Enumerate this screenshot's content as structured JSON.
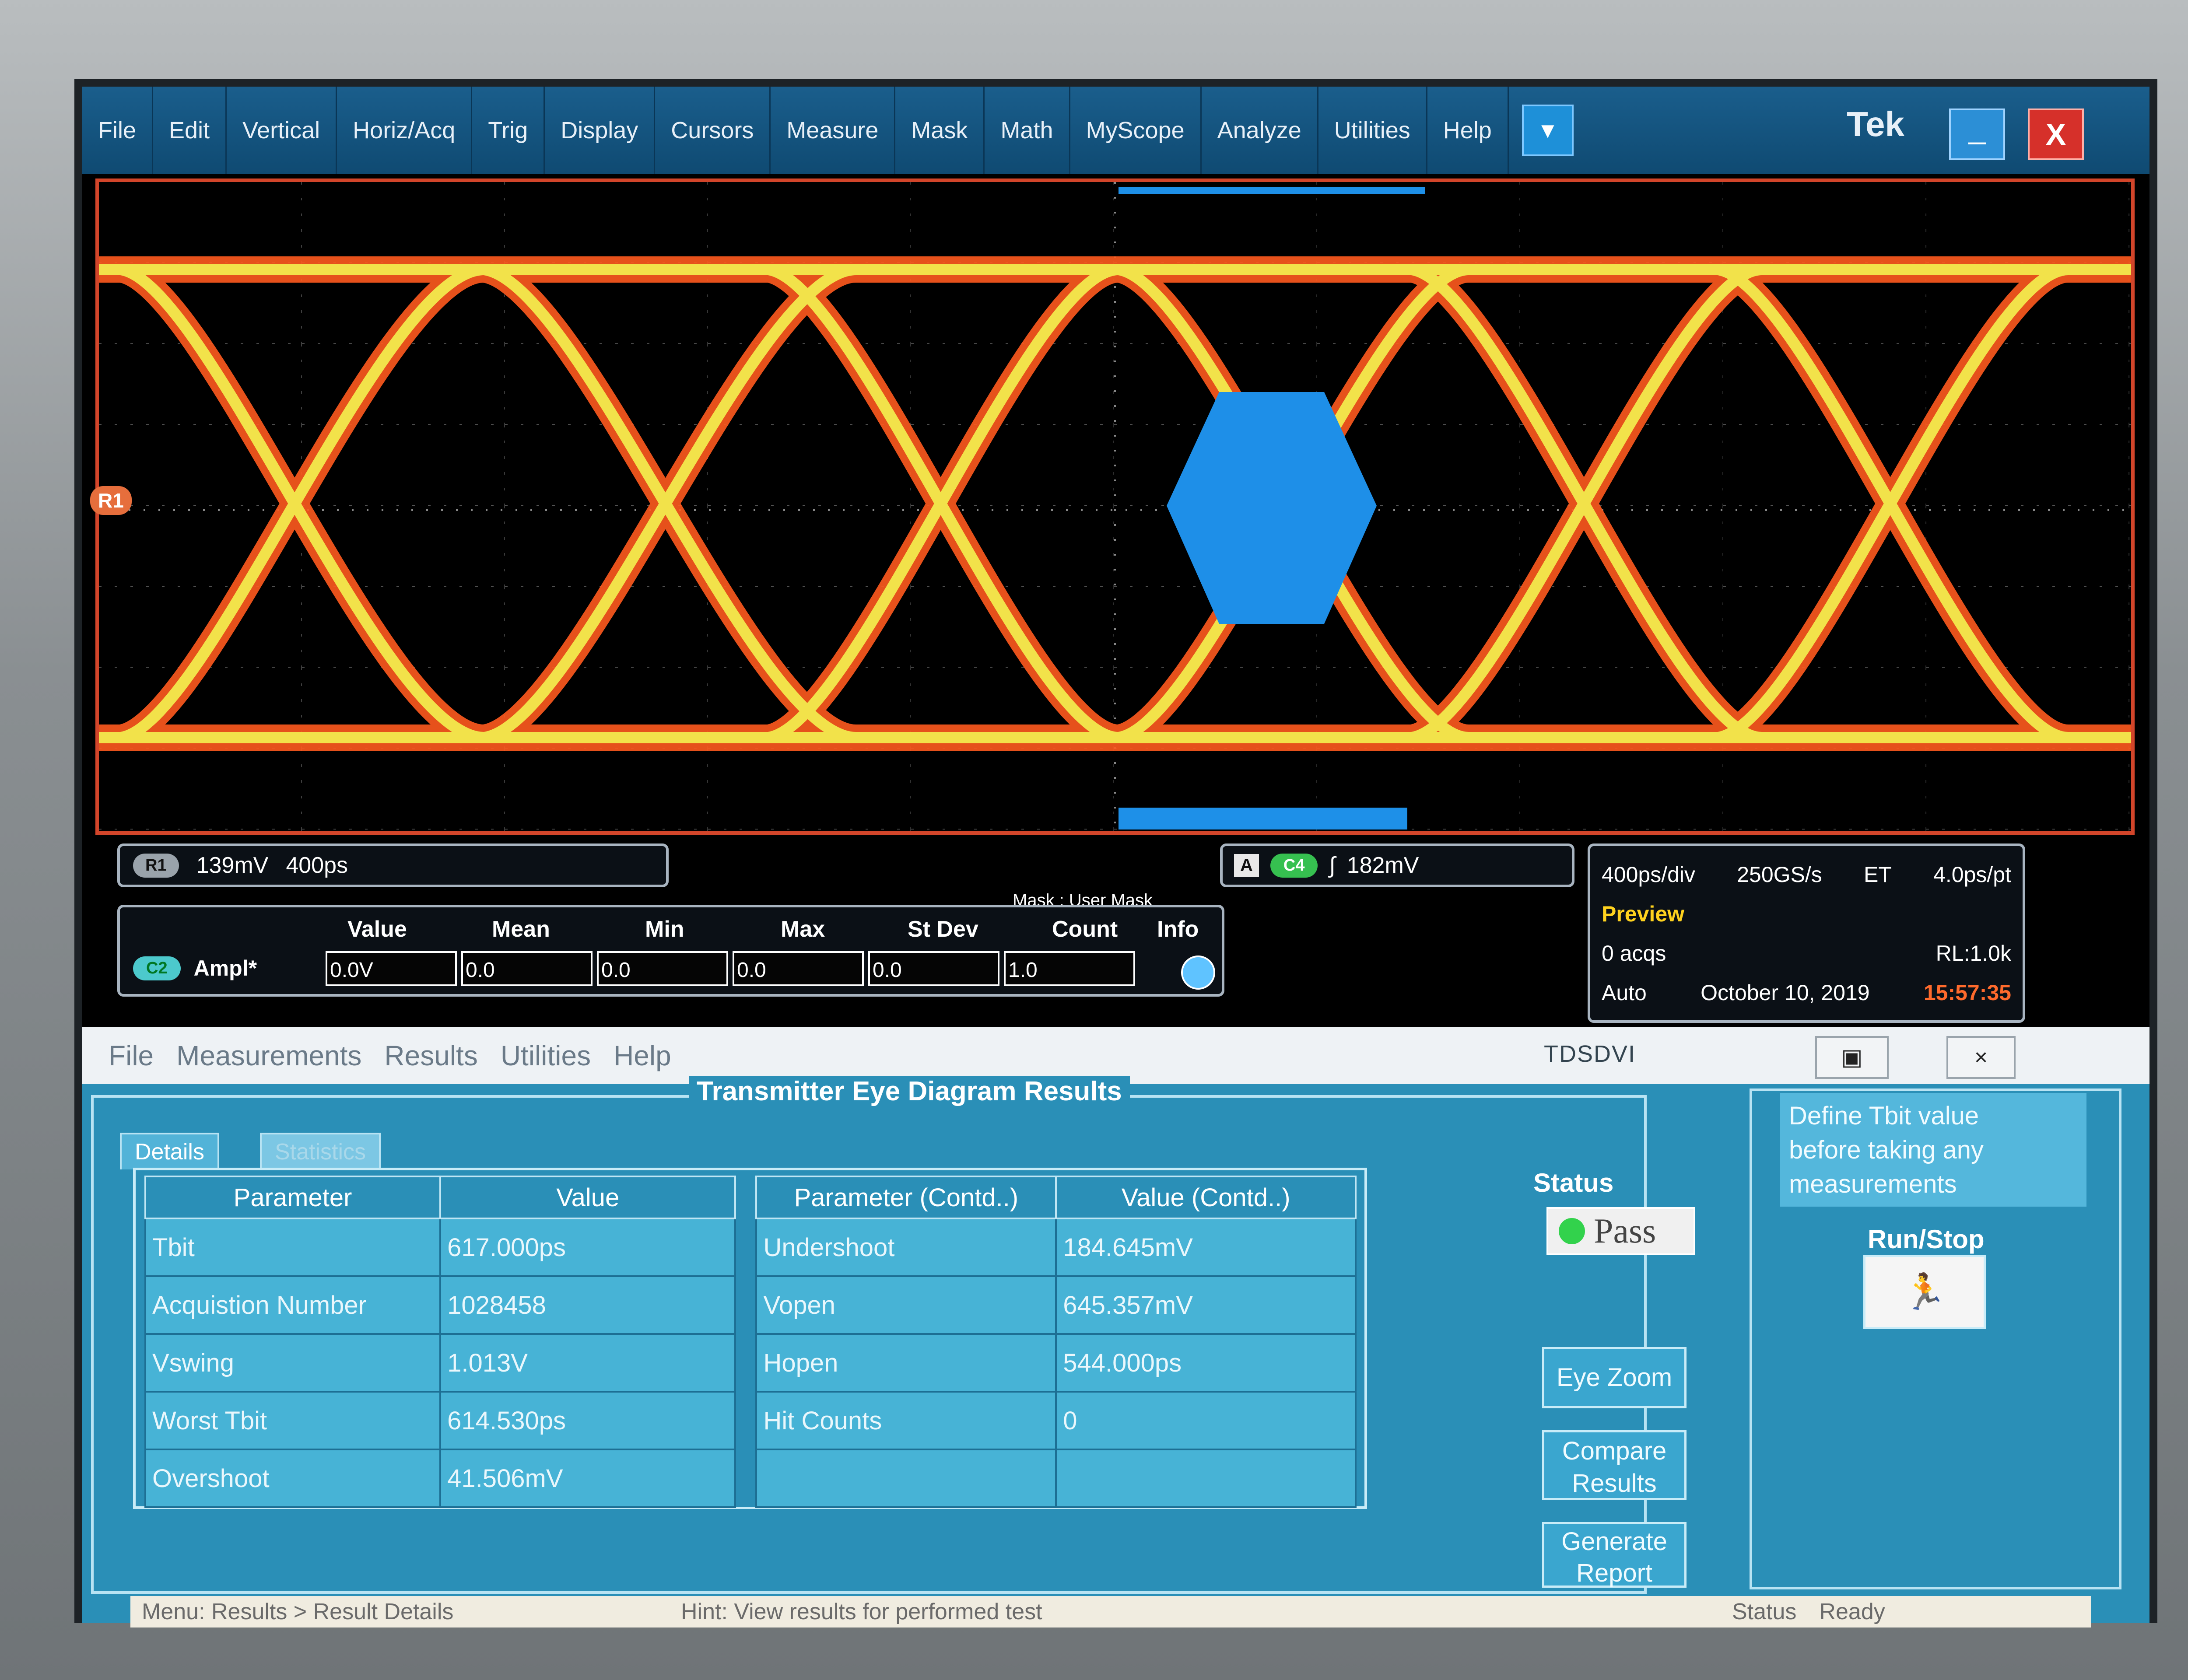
{
  "scope": {
    "menus": [
      "File",
      "Edit",
      "Vertical",
      "Horiz/Acq",
      "Trig",
      "Display",
      "Cursors",
      "Measure",
      "Mask",
      "Math",
      "MyScope",
      "Analyze",
      "Utilities",
      "Help"
    ],
    "brand": "Tek",
    "minimize_label": "_",
    "close_label": "X",
    "dropdown_icon": "▼",
    "ref_marker": "R1",
    "mask_label": "Mask : User Mask",
    "r1": {
      "tag": "R1",
      "scale": "139mV",
      "time": "400ps"
    },
    "trigger": {
      "source_letter": "A",
      "channel": "C4",
      "slope": "∫",
      "level": "182mV"
    },
    "acq": {
      "timebase": "400ps/div",
      "rate": "250GS/s",
      "mode": "ET",
      "res": "4.0ps/pt",
      "state": "Preview",
      "acqs": "0 acqs",
      "rl": "RL:1.0k",
      "trig_mode": "Auto",
      "date": "October 10, 2019",
      "time": "15:57:35"
    },
    "measurement": {
      "headers": [
        "Value",
        "Mean",
        "Min",
        "Max",
        "St Dev",
        "Count",
        "Info"
      ],
      "channel": "C2",
      "name": "Ampl*",
      "values": [
        "0.0V",
        "0.0",
        "0.0",
        "0.0",
        "0.0",
        "1.0"
      ]
    }
  },
  "app": {
    "menus": [
      "File",
      "Measurements",
      "Results",
      "Utilities",
      "Help"
    ],
    "title": "TDSDVI",
    "btn_icon": "▣",
    "close_label": "×",
    "panel_title": "Transmitter Eye Diagram Results",
    "tabs": [
      "Details",
      "Statistics"
    ],
    "table": {
      "headers": [
        "Parameter",
        "Value",
        "Parameter (Contd..)",
        "Value (Contd..)"
      ],
      "rows": [
        [
          "Tbit",
          "617.000ps",
          "Undershoot",
          "184.645mV"
        ],
        [
          "Acquistion Number",
          "1028458",
          "Vopen",
          "645.357mV"
        ],
        [
          "Vswing",
          "1.013V",
          "Hopen",
          "544.000ps"
        ],
        [
          "Worst Tbit",
          "614.530ps",
          "Hit Counts",
          "0"
        ],
        [
          "Overshoot",
          "41.506mV",
          "",
          ""
        ]
      ]
    },
    "status_label": "Status",
    "status_value": "Pass",
    "buttons": {
      "eye_zoom": "Eye Zoom",
      "compare_1": "Compare",
      "compare_2": "Results",
      "generate_1": "Generate",
      "generate_2": "Report"
    },
    "define_text": [
      "Define Tbit value",
      "before taking any",
      "measurements"
    ],
    "runstop_label": "Run/Stop",
    "runstop_icon": "🏃",
    "statusbar": {
      "menu": "Menu: Results > Result Details",
      "hint": "Hint: View results for performed test",
      "status_key": "Status",
      "status_val": "Ready"
    }
  },
  "colors": {
    "accent": "#2a8fb7",
    "eye_outer": "#ff5a1e",
    "eye_inner": "#f2e24a",
    "mask": "#1e8fe8",
    "pass": "#32d24c"
  }
}
